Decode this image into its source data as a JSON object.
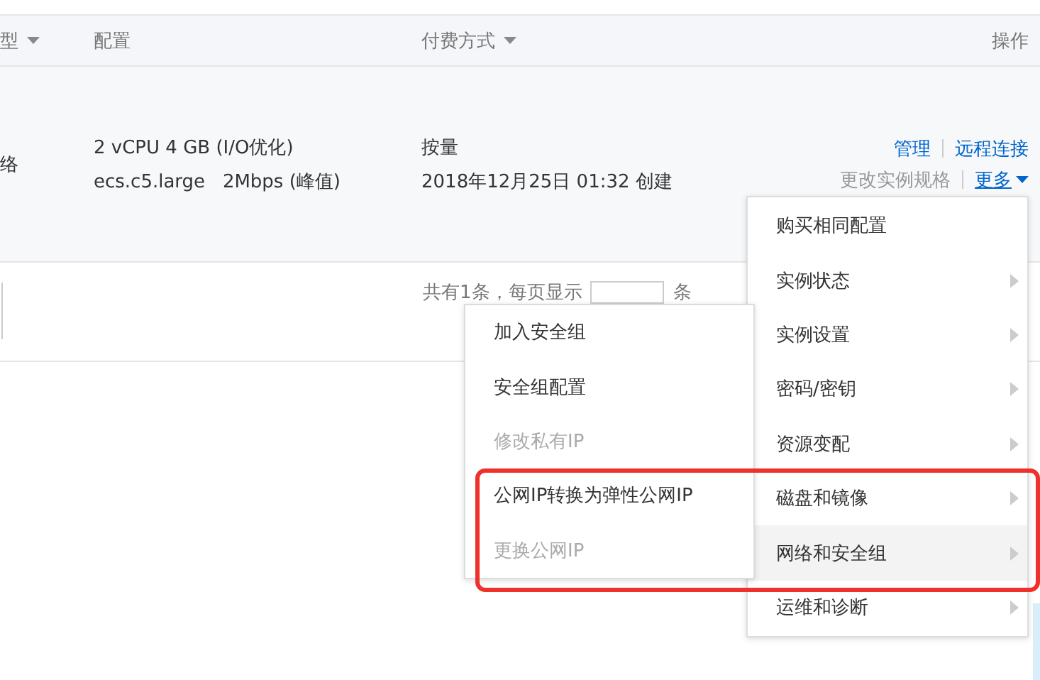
{
  "table": {
    "columns": [
      {
        "label": "型",
        "sortable": true
      },
      {
        "label": "配置",
        "sortable": false
      },
      {
        "label": "付费方式",
        "sortable": true
      },
      {
        "label": "操作",
        "sortable": false
      }
    ],
    "rows": [
      {
        "type": "络",
        "config": [
          "2 vCPU 4 GB (I/O优化)",
          "ecs.c5.large   2Mbps (峰值)"
        ],
        "billing": [
          "按量",
          "2018年12月25日 01:32 创建"
        ],
        "actions": [
          {
            "label": "管理",
            "disabled": false
          },
          {
            "label": "远程连接",
            "disabled": false
          },
          {
            "label": "更改实例规格",
            "disabled": true
          },
          {
            "label": "更多",
            "disabled": false,
            "dropdown": true
          }
        ]
      }
    ]
  },
  "pager": {
    "label": "共有1条，每页显示",
    "suffix": "条"
  },
  "menu": {
    "items": [
      {
        "label": "购买相同配置",
        "submenu": false,
        "selected": false
      },
      {
        "label": "实例状态",
        "submenu": true,
        "selected": false
      },
      {
        "label": "实例设置",
        "submenu": true,
        "selected": false
      },
      {
        "label": "密码/密钥",
        "submenu": true,
        "selected": false
      },
      {
        "label": "资源变配",
        "submenu": true,
        "selected": false
      },
      {
        "label": "磁盘和镜像",
        "submenu": true,
        "selected": false
      },
      {
        "label": "网络和安全组",
        "submenu": true,
        "selected": true
      },
      {
        "label": "运维和诊断",
        "submenu": true,
        "selected": false
      }
    ]
  },
  "submenu": {
    "items": [
      {
        "label": "加入安全组",
        "disabled": false
      },
      {
        "label": "安全组配置",
        "disabled": false
      },
      {
        "label": "修改私有IP",
        "disabled": true
      },
      {
        "label": "公网IP转换为弹性公网IP",
        "disabled": false
      },
      {
        "label": "更换公网IP",
        "disabled": true
      }
    ]
  }
}
